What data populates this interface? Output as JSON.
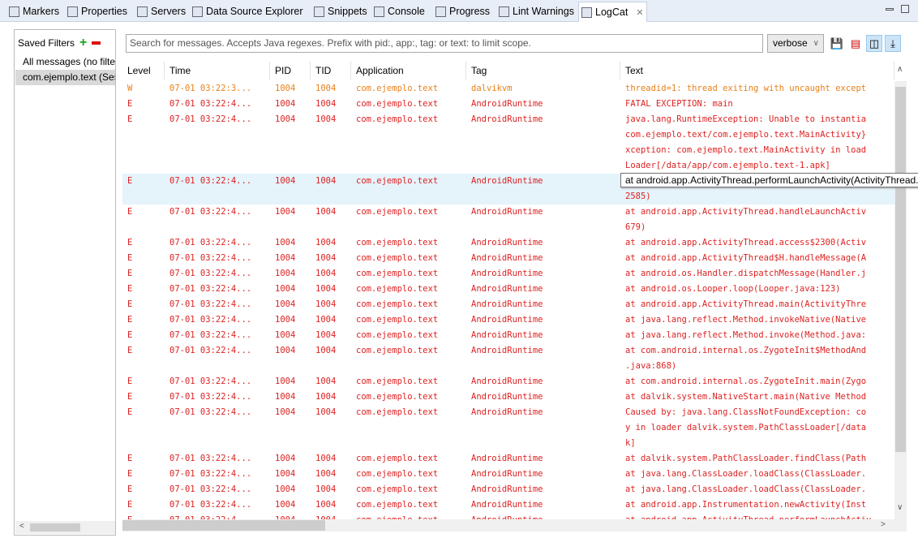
{
  "tabs": [
    {
      "label": "Markers",
      "icon": "markers-icon"
    },
    {
      "label": "Properties",
      "icon": "properties-icon"
    },
    {
      "label": "Servers",
      "icon": "servers-icon"
    },
    {
      "label": "Data Source Explorer",
      "icon": "data-source-icon"
    },
    {
      "label": "Snippets",
      "icon": "snippets-icon"
    },
    {
      "label": "Console",
      "icon": "console-icon"
    },
    {
      "label": "Progress",
      "icon": "progress-icon"
    },
    {
      "label": "Lint Warnings",
      "icon": "lint-icon"
    },
    {
      "label": "LogCat",
      "icon": "logcat-icon",
      "active": true
    }
  ],
  "filters": {
    "title": "Saved Filters",
    "items": [
      "All messages (no filters)",
      "com.ejemplo.text (Session Filter)"
    ],
    "selected": 1
  },
  "search": {
    "placeholder": "Search for messages. Accepts Java regexes. Prefix with pid:, app:, tag: or text: to limit scope."
  },
  "level_select": {
    "value": "verbose"
  },
  "columns": [
    "Level",
    "Time",
    "PID",
    "TID",
    "Application",
    "Tag",
    "Text"
  ],
  "colors": {
    "error": "#dd2222",
    "warn": "#e8801a",
    "highlight": "#e5f3fb"
  },
  "tooltip": "at android.app.ActivityThread.performLaunchActivity(ActivityThread.java:",
  "rows": [
    {
      "level": "W",
      "time": "07-01 03:22:3...",
      "pid": "1004",
      "tid": "1004",
      "app": "com.ejemplo.text",
      "tag": "dalvikvm",
      "text": [
        "threadid=1: thread exiting with uncaught except"
      ]
    },
    {
      "level": "E",
      "time": "07-01 03:22:4...",
      "pid": "1004",
      "tid": "1004",
      "app": "com.ejemplo.text",
      "tag": "AndroidRuntime",
      "text": [
        "FATAL EXCEPTION: main"
      ]
    },
    {
      "level": "E",
      "time": "07-01 03:22:4...",
      "pid": "1004",
      "tid": "1004",
      "app": "com.ejemplo.text",
      "tag": "AndroidRuntime",
      "text": [
        "java.lang.RuntimeException: Unable to instantia",
        "com.ejemplo.text/com.ejemplo.text.MainActivity}",
        "xception: com.ejemplo.text.MainActivity in load",
        "Loader[/data/app/com.ejemplo.text-1.apk]"
      ]
    },
    {
      "level": "E",
      "time": "07-01 03:22:4...",
      "pid": "1004",
      "tid": "1004",
      "app": "com.ejemplo.text",
      "tag": "AndroidRuntime",
      "text": [
        "at android.app.ActivityThread.performLaunchActiv",
        "2585)"
      ],
      "highlight": true
    },
    {
      "level": "E",
      "time": "07-01 03:22:4...",
      "pid": "1004",
      "tid": "1004",
      "app": "com.ejemplo.text",
      "tag": "AndroidRuntime",
      "text": [
        "at android.app.ActivityThread.handleLaunchActiv",
        "679)"
      ]
    },
    {
      "level": "E",
      "time": "07-01 03:22:4...",
      "pid": "1004",
      "tid": "1004",
      "app": "com.ejemplo.text",
      "tag": "AndroidRuntime",
      "text": [
        "at android.app.ActivityThread.access$2300(Activ"
      ]
    },
    {
      "level": "E",
      "time": "07-01 03:22:4...",
      "pid": "1004",
      "tid": "1004",
      "app": "com.ejemplo.text",
      "tag": "AndroidRuntime",
      "text": [
        "at android.app.ActivityThread$H.handleMessage(A"
      ]
    },
    {
      "level": "E",
      "time": "07-01 03:22:4...",
      "pid": "1004",
      "tid": "1004",
      "app": "com.ejemplo.text",
      "tag": "AndroidRuntime",
      "text": [
        "at android.os.Handler.dispatchMessage(Handler.j"
      ]
    },
    {
      "level": "E",
      "time": "07-01 03:22:4...",
      "pid": "1004",
      "tid": "1004",
      "app": "com.ejemplo.text",
      "tag": "AndroidRuntime",
      "text": [
        "at android.os.Looper.loop(Looper.java:123)"
      ]
    },
    {
      "level": "E",
      "time": "07-01 03:22:4...",
      "pid": "1004",
      "tid": "1004",
      "app": "com.ejemplo.text",
      "tag": "AndroidRuntime",
      "text": [
        "at android.app.ActivityThread.main(ActivityThre"
      ]
    },
    {
      "level": "E",
      "time": "07-01 03:22:4...",
      "pid": "1004",
      "tid": "1004",
      "app": "com.ejemplo.text",
      "tag": "AndroidRuntime",
      "text": [
        "at java.lang.reflect.Method.invokeNative(Native"
      ]
    },
    {
      "level": "E",
      "time": "07-01 03:22:4...",
      "pid": "1004",
      "tid": "1004",
      "app": "com.ejemplo.text",
      "tag": "AndroidRuntime",
      "text": [
        "at java.lang.reflect.Method.invoke(Method.java:"
      ]
    },
    {
      "level": "E",
      "time": "07-01 03:22:4...",
      "pid": "1004",
      "tid": "1004",
      "app": "com.ejemplo.text",
      "tag": "AndroidRuntime",
      "text": [
        "at com.android.internal.os.ZygoteInit$MethodAnd",
        ".java:868)"
      ]
    },
    {
      "level": "E",
      "time": "07-01 03:22:4...",
      "pid": "1004",
      "tid": "1004",
      "app": "com.ejemplo.text",
      "tag": "AndroidRuntime",
      "text": [
        "at com.android.internal.os.ZygoteInit.main(Zygo"
      ]
    },
    {
      "level": "E",
      "time": "07-01 03:22:4...",
      "pid": "1004",
      "tid": "1004",
      "app": "com.ejemplo.text",
      "tag": "AndroidRuntime",
      "text": [
        "at dalvik.system.NativeStart.main(Native Method"
      ]
    },
    {
      "level": "E",
      "time": "07-01 03:22:4...",
      "pid": "1004",
      "tid": "1004",
      "app": "com.ejemplo.text",
      "tag": "AndroidRuntime",
      "text": [
        "Caused by: java.lang.ClassNotFoundException: co",
        "y in loader dalvik.system.PathClassLoader[/data",
        "k]"
      ]
    },
    {
      "level": "E",
      "time": "07-01 03:22:4...",
      "pid": "1004",
      "tid": "1004",
      "app": "com.ejemplo.text",
      "tag": "AndroidRuntime",
      "text": [
        "at dalvik.system.PathClassLoader.findClass(Path"
      ]
    },
    {
      "level": "E",
      "time": "07-01 03:22:4...",
      "pid": "1004",
      "tid": "1004",
      "app": "com.ejemplo.text",
      "tag": "AndroidRuntime",
      "text": [
        "at java.lang.ClassLoader.loadClass(ClassLoader."
      ]
    },
    {
      "level": "E",
      "time": "07-01 03:22:4...",
      "pid": "1004",
      "tid": "1004",
      "app": "com.ejemplo.text",
      "tag": "AndroidRuntime",
      "text": [
        "at java.lang.ClassLoader.loadClass(ClassLoader."
      ]
    },
    {
      "level": "E",
      "time": "07-01 03:22:4...",
      "pid": "1004",
      "tid": "1004",
      "app": "com.ejemplo.text",
      "tag": "AndroidRuntime",
      "text": [
        "at android.app.Instrumentation.newActivity(Inst"
      ]
    },
    {
      "level": "E",
      "time": "07-01 03:22:4...",
      "pid": "1004",
      "tid": "1004",
      "app": "com.ejemplo.text",
      "tag": "AndroidRuntime",
      "text": [
        "at android.app.ActivityThread.performLaunchActiv"
      ]
    }
  ]
}
